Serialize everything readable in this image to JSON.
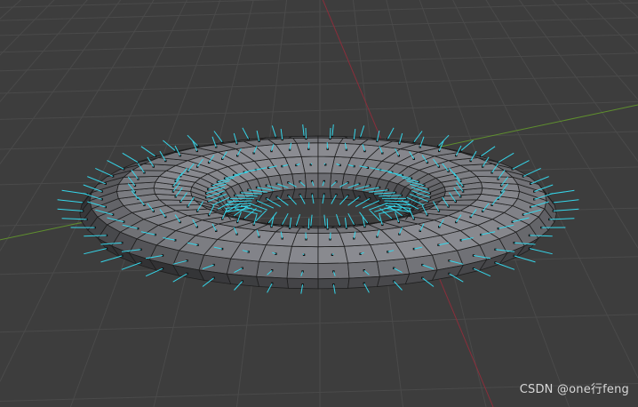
{
  "viewport": {
    "background": "#3d3d3d",
    "grid_color": "#4a4a4a",
    "axis_x_color": "#8a2e3b",
    "axis_y_color": "#5f8f2e",
    "object": "torus",
    "display": "face-normals",
    "face_color": "#8e8f95",
    "edge_color": "#1e1e1e",
    "normal_color": "#35d6ea",
    "segments": 48,
    "ring_segments": 12
  },
  "watermark": {
    "text": "CSDN @one行feng"
  }
}
